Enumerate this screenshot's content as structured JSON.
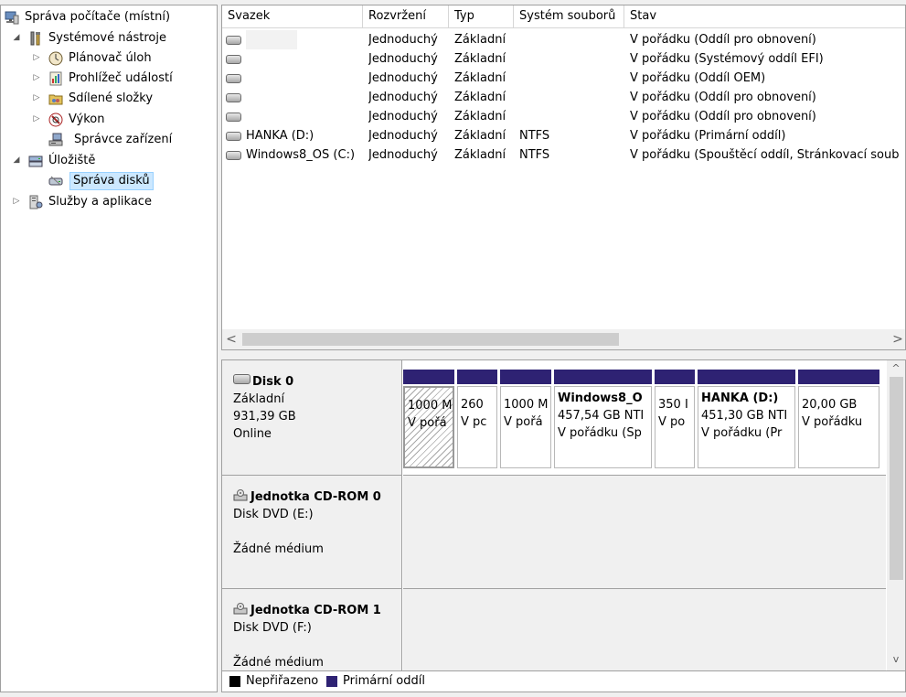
{
  "tree": {
    "root": "Správa počítače (místní)",
    "system_tools": "Systémové nástroje",
    "task_scheduler": "Plánovač úloh",
    "event_viewer": "Prohlížeč událostí",
    "shared_folders": "Sdílené složky",
    "performance": "Výkon",
    "device_manager": "Správce zařízení",
    "storage": "Úložiště",
    "disk_management": "Správa disků",
    "services_apps": "Služby a aplikace"
  },
  "volumes": {
    "headers": [
      "Svazek",
      "Rozvržení",
      "Typ",
      "Systém souborů",
      "Stav"
    ],
    "rows": [
      {
        "name": "",
        "layout": "Jednoduchý",
        "type": "Základní",
        "fs": "",
        "status": "V pořádku (Oddíl pro obnovení)"
      },
      {
        "name": "",
        "layout": "Jednoduchý",
        "type": "Základní",
        "fs": "",
        "status": "V pořádku (Systémový oddíl EFI)"
      },
      {
        "name": "",
        "layout": "Jednoduchý",
        "type": "Základní",
        "fs": "",
        "status": "V pořádku (Oddíl OEM)"
      },
      {
        "name": "",
        "layout": "Jednoduchý",
        "type": "Základní",
        "fs": "",
        "status": "V pořádku (Oddíl pro obnovení)"
      },
      {
        "name": "",
        "layout": "Jednoduchý",
        "type": "Základní",
        "fs": "",
        "status": "V pořádku (Oddíl pro obnovení)"
      },
      {
        "name": "HANKA (D:)",
        "layout": "Jednoduchý",
        "type": "Základní",
        "fs": "NTFS",
        "status": "V pořádku (Primární oddíl)"
      },
      {
        "name": "Windows8_OS (C:)",
        "layout": "Jednoduchý",
        "type": "Základní",
        "fs": "NTFS",
        "status": "V pořádku (Spouštěcí oddíl, Stránkovací soub"
      }
    ],
    "scroll_left": "<",
    "scroll_right": ">"
  },
  "disks": {
    "disk0": {
      "title": "Disk 0",
      "type": "Základní",
      "size": "931,39 GB",
      "state": "Online",
      "partitions": [
        {
          "name": "",
          "size": "1000 M",
          "status": "V pořá"
        },
        {
          "name": "",
          "size": "260",
          "status": "V pc"
        },
        {
          "name": "",
          "size": "1000 M",
          "status": "V pořá"
        },
        {
          "name": "Windows8_O",
          "size": "457,54 GB NTI",
          "status": "V pořádku (Sp"
        },
        {
          "name": "",
          "size": "350 I",
          "status": "V po"
        },
        {
          "name": "HANKA  (D:)",
          "size": "451,30 GB NTI",
          "status": "V pořádku (Pr"
        },
        {
          "name": "",
          "size": "20,00 GB",
          "status": "V pořádku"
        }
      ]
    },
    "cd0": {
      "title": "Jednotka CD-ROM 0",
      "sub": "Disk DVD (E:)",
      "media": "Žádné médium"
    },
    "cd1": {
      "title": "Jednotka CD-ROM 1",
      "sub": "Disk DVD (F:)",
      "media": "Žádné médium"
    },
    "scroll_up": "^",
    "scroll_down": "v"
  },
  "legend": {
    "unallocated": "Nepřiřazeno",
    "primary": "Primární oddíl",
    "unallocated_color": "#000000",
    "primary_color": "#2e2273"
  }
}
